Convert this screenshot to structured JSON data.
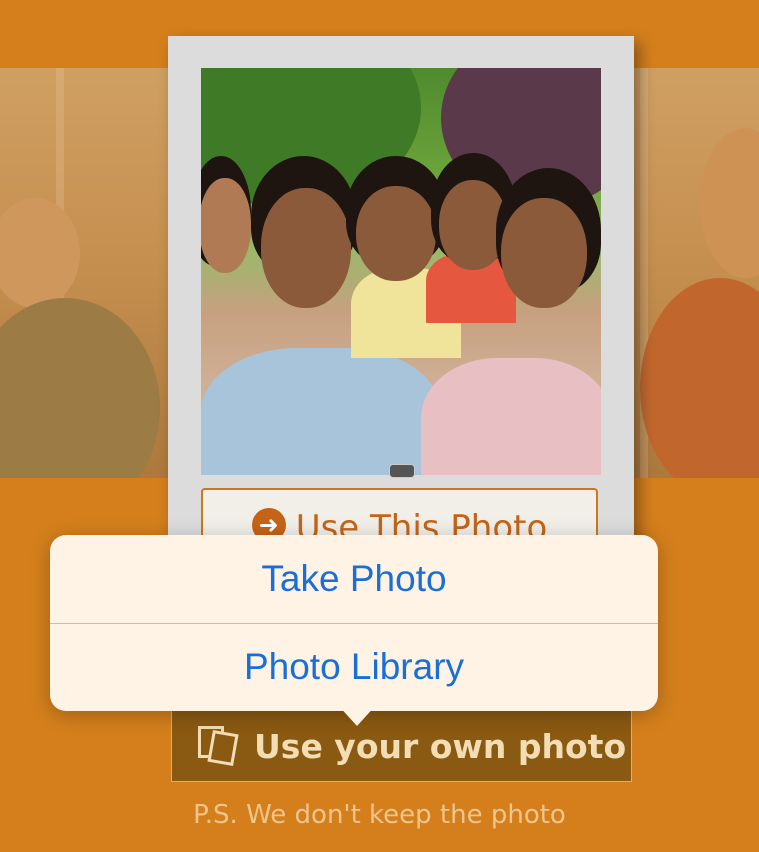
{
  "card": {
    "use_this_photo_label": "Use This Photo"
  },
  "action_sheet": {
    "take_photo_label": "Take Photo",
    "photo_library_label": "Photo Library"
  },
  "own_photo_button": {
    "label": "Use your own photo"
  },
  "footer": {
    "note": "P.S. We don't keep the photo"
  },
  "icons": {
    "use_this_photo": "arrow-right-circle-icon",
    "use_own_photo": "photo-stack-icon"
  },
  "colors": {
    "background": "#d47f1c",
    "action_text": "#1a6fd6",
    "accent": "#c56416",
    "own_photo_button": "#8b5a12"
  }
}
